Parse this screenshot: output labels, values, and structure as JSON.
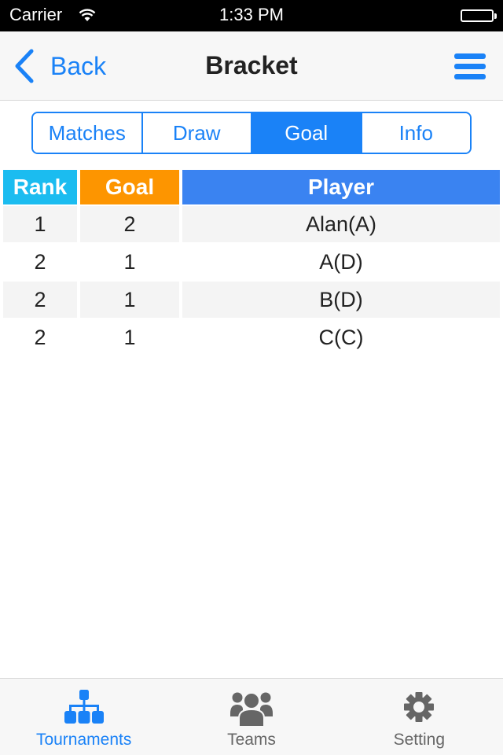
{
  "status_bar": {
    "carrier": "Carrier",
    "time": "1:33 PM",
    "wifi_icon": "wifi-icon",
    "battery_icon": "battery-icon"
  },
  "nav": {
    "back_label": "Back",
    "back_icon": "chevron-left-icon",
    "title": "Bracket",
    "menu_icon": "hamburger-menu-icon"
  },
  "segments": [
    {
      "label": "Matches",
      "active": false
    },
    {
      "label": "Draw",
      "active": false
    },
    {
      "label": "Goal",
      "active": true
    },
    {
      "label": "Info",
      "active": false
    }
  ],
  "table": {
    "headers": {
      "rank": "Rank",
      "goal": "Goal",
      "player": "Player"
    },
    "header_colors": {
      "rank": "#1bbcf0",
      "goal": "#fd9500",
      "player": "#3a83f1"
    },
    "rows": [
      {
        "rank": "1",
        "goal": "2",
        "player": "Alan(A)"
      },
      {
        "rank": "2",
        "goal": "1",
        "player": "A(D)"
      },
      {
        "rank": "2",
        "goal": "1",
        "player": "B(D)"
      },
      {
        "rank": "2",
        "goal": "1",
        "player": "C(C)"
      }
    ]
  },
  "tabbar": {
    "items": [
      {
        "label": "Tournaments",
        "icon": "bracket-hierarchy-icon",
        "active": true
      },
      {
        "label": "Teams",
        "icon": "group-users-icon",
        "active": false
      },
      {
        "label": "Setting",
        "icon": "gear-icon",
        "active": false
      }
    ]
  },
  "colors": {
    "accent": "#1a82f7",
    "inactive": "#666666"
  }
}
